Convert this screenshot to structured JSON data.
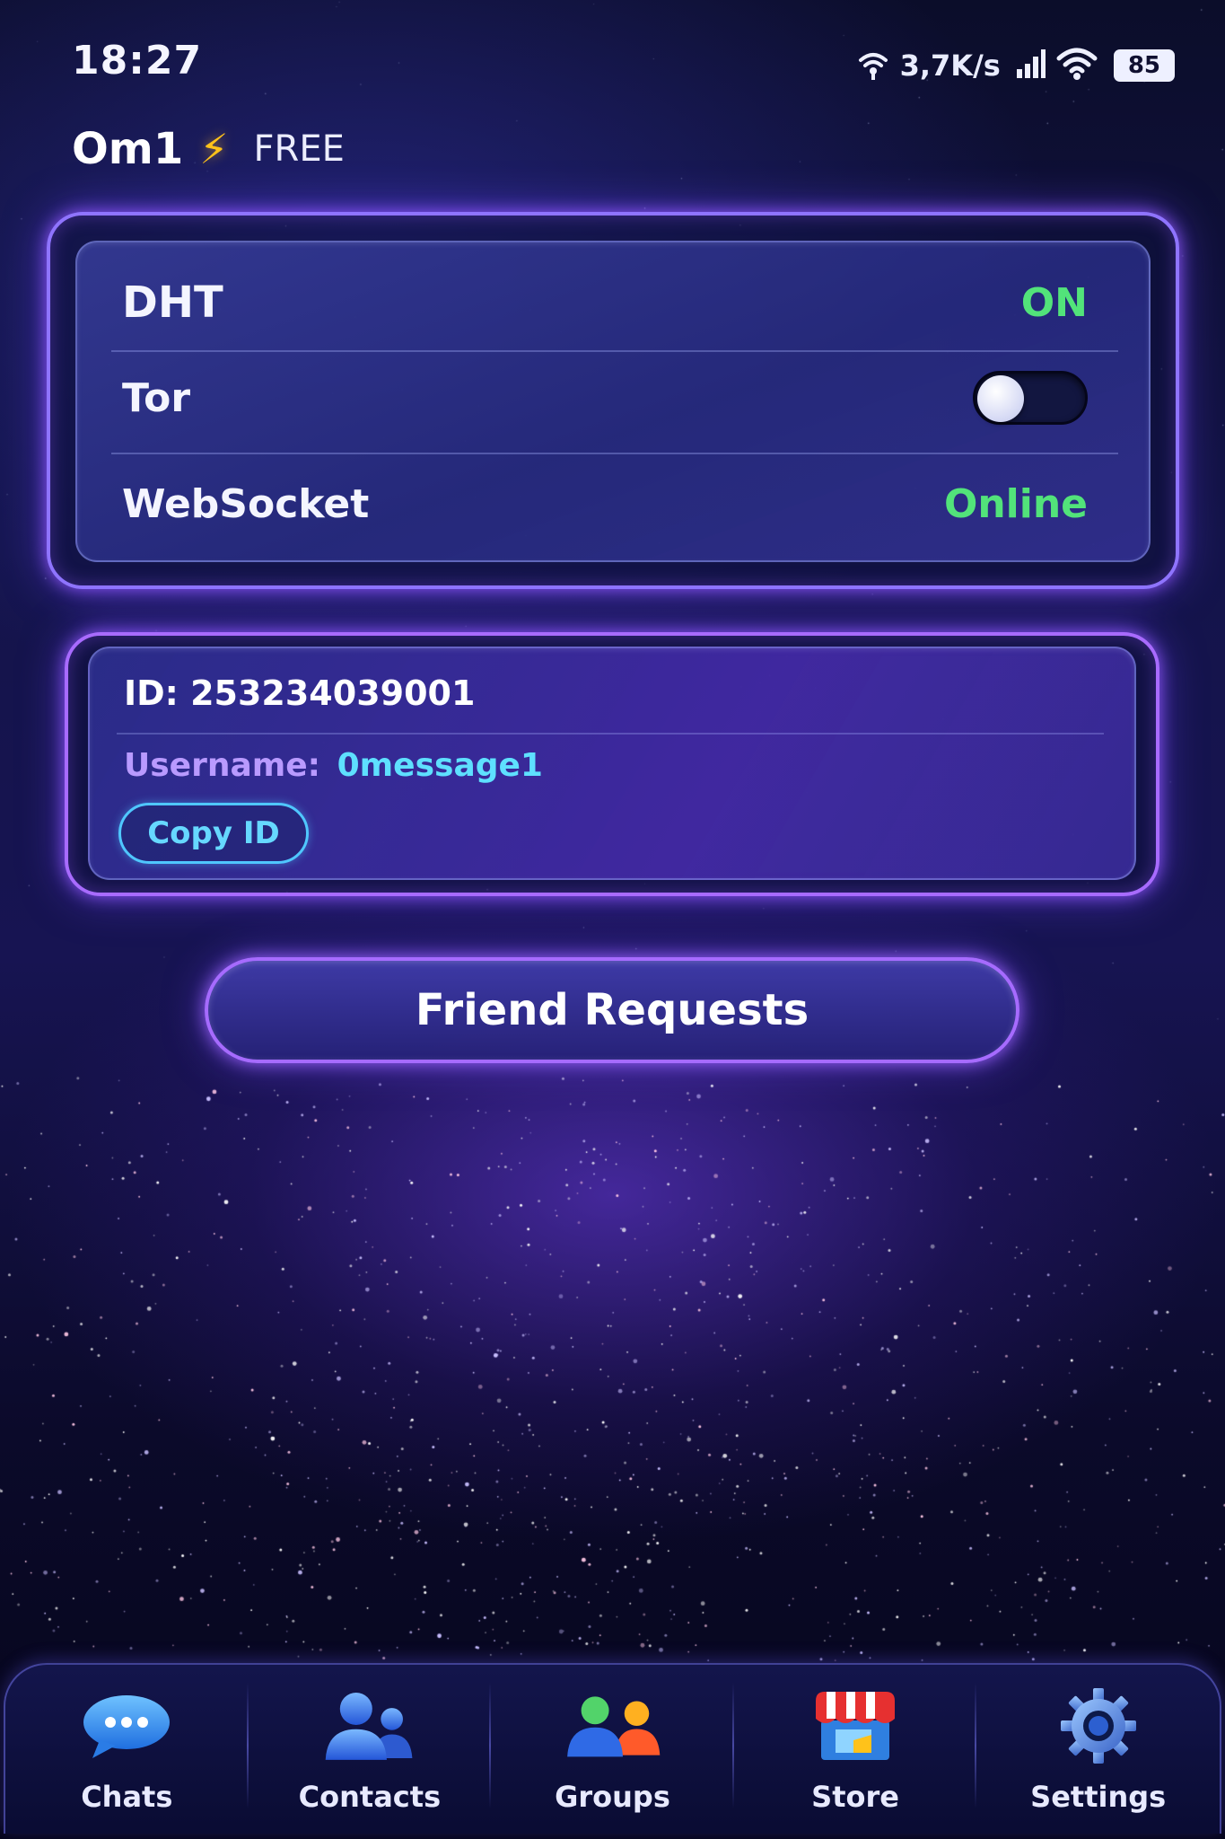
{
  "status_bar": {
    "time": "18:27",
    "net_speed": "3,7K/s",
    "battery": "85"
  },
  "header": {
    "title": "Om1",
    "plan": "FREE",
    "bolt_icon": "lightning-bolt-icon"
  },
  "network": {
    "dht": {
      "label": "DHT",
      "status": "ON"
    },
    "tor": {
      "label": "Tor",
      "enabled": false
    },
    "websocket": {
      "label": "WebSocket",
      "status": "Online"
    }
  },
  "identity": {
    "id_text": "ID: 253234039001",
    "username_label": "Username:",
    "username": "0message1",
    "copy_label": "Copy ID"
  },
  "friend_requests_label": "Friend Requests",
  "nav": [
    {
      "label": "Chats",
      "icon": "chat-bubble-icon"
    },
    {
      "label": "Contacts",
      "icon": "contacts-icon"
    },
    {
      "label": "Groups",
      "icon": "groups-icon"
    },
    {
      "label": "Store",
      "icon": "store-icon"
    },
    {
      "label": "Settings",
      "icon": "gear-icon"
    }
  ],
  "colors": {
    "status_green": "#52e37a",
    "accent_purple": "#9b6bff",
    "accent_cyan": "#4fc7ff",
    "bolt_yellow": "#ffc21a"
  }
}
